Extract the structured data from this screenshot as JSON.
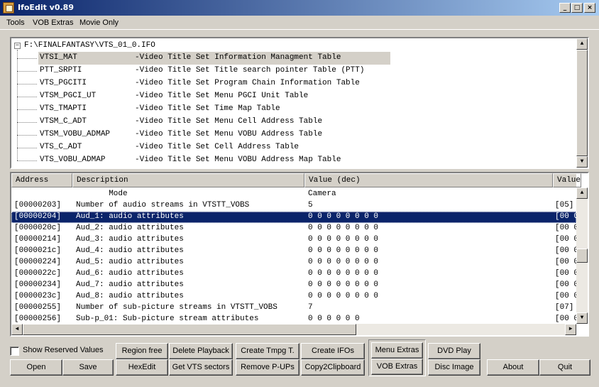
{
  "window": {
    "title": "IfoEdit v0.89",
    "minimize": "_",
    "maximize": "□",
    "close": "×"
  },
  "menu": [
    "Tools",
    "VOB Extras",
    "Movie Only"
  ],
  "tree": {
    "expander": "−",
    "root": "F:\\FINALFANTASY\\VTS_01_0.IFO",
    "items": [
      {
        "name": "VTSI_MAT",
        "desc": "-Video Title Set Information Managment Table",
        "selected": true
      },
      {
        "name": "PTT_SRPTI",
        "desc": "-Video Title Set Title search pointer Table (PTT)"
      },
      {
        "name": "VTS_PGCITI",
        "desc": "-Video Title Set Program Chain Information Table"
      },
      {
        "name": "VTSM_PGCI_UT",
        "desc": "-Video Title Set Menu PGCI Unit Table"
      },
      {
        "name": "VTS_TMAPTI",
        "desc": "-Video Title Set Time Map Table"
      },
      {
        "name": "VTSM_C_ADT",
        "desc": "-Video Title Set Menu Cell Address Table"
      },
      {
        "name": "VTSM_VOBU_ADMAP",
        "desc": "-Video Title Set Menu VOBU Address Table"
      },
      {
        "name": "VTS_C_ADT",
        "desc": "-Video Title Set Cell Address Table"
      },
      {
        "name": "VTS_VOBU_ADMAP",
        "desc": "-Video Title Set Menu VOBU Address Map Table"
      }
    ]
  },
  "grid": {
    "headers": [
      "Address",
      "Description",
      "Value (dec)",
      "Value"
    ],
    "rows": [
      {
        "addr": "",
        "desc": "       Mode",
        "val": "Camera",
        "hex": ""
      },
      {
        "addr": "[00000203]",
        "desc": "Number of audio streams in VTSTT_VOBS",
        "val": "5",
        "hex": "[05]"
      },
      {
        "addr": "[00000204]",
        "desc": "Aud_1: audio attributes",
        "val": "0 0 0 0 0 0 0 0",
        "hex": "[00 0",
        "selected": true
      },
      {
        "addr": "[0000020c]",
        "desc": "Aud_2: audio attributes",
        "val": "0 0 0 0 0 0 0 0",
        "hex": "[00 0"
      },
      {
        "addr": "[00000214]",
        "desc": "Aud_3: audio attributes",
        "val": "0 0 0 0 0 0 0 0",
        "hex": "[00 0"
      },
      {
        "addr": "[0000021c]",
        "desc": "Aud_4: audio attributes",
        "val": "0 0 0 0 0 0 0 0",
        "hex": "[00 0"
      },
      {
        "addr": "[00000224]",
        "desc": "Aud_5: audio attributes",
        "val": "0 0 0 0 0 0 0 0",
        "hex": "[00 0"
      },
      {
        "addr": "[0000022c]",
        "desc": "Aud_6: audio attributes",
        "val": "0 0 0 0 0 0 0 0",
        "hex": "[00 0"
      },
      {
        "addr": "[00000234]",
        "desc": "Aud_7: audio attributes",
        "val": "0 0 0 0 0 0 0 0",
        "hex": "[00 0"
      },
      {
        "addr": "[0000023c]",
        "desc": "Aud_8: audio attributes",
        "val": "0 0 0 0 0 0 0 0",
        "hex": "[00 0"
      },
      {
        "addr": "[00000255]",
        "desc": "Number of sub-picture streams in VTSTT_VOBS",
        "val": "7",
        "hex": "[07]"
      },
      {
        "addr": "[00000256]",
        "desc": "Sub-p_01: Sub-picture stream attributes",
        "val": "0 0 0 0 0 0",
        "hex": "[00 0"
      }
    ]
  },
  "scroll": {
    "up": "▲",
    "down": "▼",
    "left": "◄",
    "right": "►"
  },
  "options": {
    "show_reserved": "Show Reserved Values"
  },
  "buttons": {
    "open": "Open",
    "save": "Save",
    "region_free": "Region free",
    "hexedit": "HexEdit",
    "delete_playback": "Delete Playback",
    "get_vts_sectors": "Get VTS sectors",
    "create_tmpg": "Create Tmpg T.",
    "remove_pups": "Remove P-UPs",
    "create_ifos": "Create IFOs",
    "copy2clipboard": "Copy2Clipboard",
    "menu_extras": "Menu Extras",
    "vob_extras": "VOB Extras",
    "dvd_play": "DVD Play",
    "disc_image": "Disc Image",
    "about": "About",
    "quit": "Quit"
  }
}
